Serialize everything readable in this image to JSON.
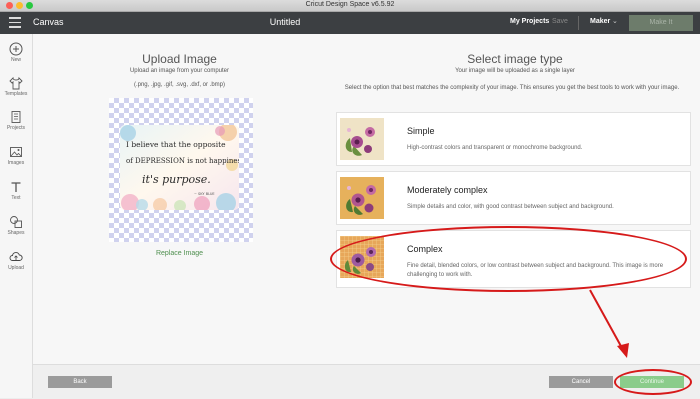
{
  "window": {
    "app_title": "Cricut Design Space  v6.5.92"
  },
  "topbar": {
    "workspace_label": "Canvas",
    "document_title": "Untitled",
    "my_projects": "My Projects",
    "save": "Save",
    "machine": "Maker",
    "make_it": "Make It"
  },
  "sidebar": {
    "items": [
      {
        "label": "New",
        "icon": "plus-circle-icon"
      },
      {
        "label": "Templates",
        "icon": "tshirt-icon"
      },
      {
        "label": "Projects",
        "icon": "projects-icon"
      },
      {
        "label": "Images",
        "icon": "images-icon"
      },
      {
        "label": "Text",
        "icon": "text-icon"
      },
      {
        "label": "Shapes",
        "icon": "shapes-icon"
      },
      {
        "label": "Upload",
        "icon": "cloud-upload-icon"
      }
    ]
  },
  "upload": {
    "title": "Upload Image",
    "description": "Upload an image from your computer",
    "formats": "(.png, .jpg, .gif, .svg, .dxf, or .bmp)",
    "quote_line1": "I believe that the opposite",
    "quote_line2": "of DEPRESSION is not happiness,",
    "quote_line3": "it's purpose.",
    "quote_author": "~ SKY BLUE",
    "replace_label": "Replace Image"
  },
  "image_type": {
    "title": "Select image type",
    "subtitle": "Your image will be uploaded as a single layer",
    "description": "Select the option that best matches the complexity of your image. This ensures you get the best tools to work with your image.",
    "options": [
      {
        "title": "Simple",
        "description": "High-contrast colors and transparent or monochrome background."
      },
      {
        "title": "Moderately complex",
        "description": "Simple details and color, with good contrast between subject and background."
      },
      {
        "title": "Complex",
        "description": "Fine detail, blended colors, or low contrast between subject and background. This image is more challenging to work with."
      }
    ]
  },
  "footer": {
    "back": "Back",
    "cancel": "Cancel",
    "continue": "Continue"
  },
  "colors": {
    "topbar_bg": "#3c3f42",
    "accent_green": "#8bcc8b",
    "annotation_red": "#d61a1a",
    "checker": "#d0d2ee"
  }
}
